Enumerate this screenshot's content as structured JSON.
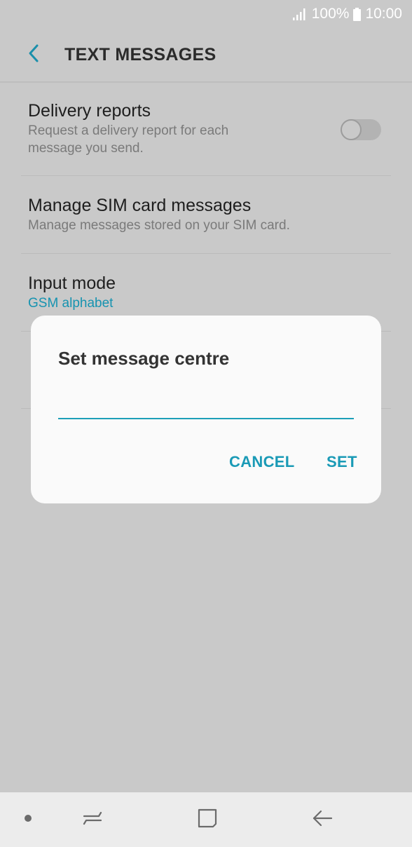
{
  "status_bar": {
    "battery_text": "100%",
    "time": "10:00"
  },
  "app_bar": {
    "title": "TEXT MESSAGES",
    "back_icon": "chevron-left-icon"
  },
  "settings": [
    {
      "title": "Delivery reports",
      "summary": "Request a delivery report for each message you send.",
      "toggle_on": false
    },
    {
      "title": "Manage SIM card messages",
      "summary": "Manage messages stored on your SIM card."
    },
    {
      "title": "Input mode",
      "summary": "GSM alphabet"
    }
  ],
  "dialog": {
    "title": "Set message centre",
    "input_value": "",
    "cancel_label": "CANCEL",
    "set_label": "SET"
  },
  "nav_bar": {
    "icons": [
      "dot-icon",
      "recent-apps-icon",
      "home-icon",
      "back-arrow-icon"
    ]
  },
  "colors": {
    "accent": "#1a9ab6",
    "background": "#c9c9c9",
    "dialog_bg": "#fafafa",
    "nav_bar_bg": "#ececec"
  }
}
